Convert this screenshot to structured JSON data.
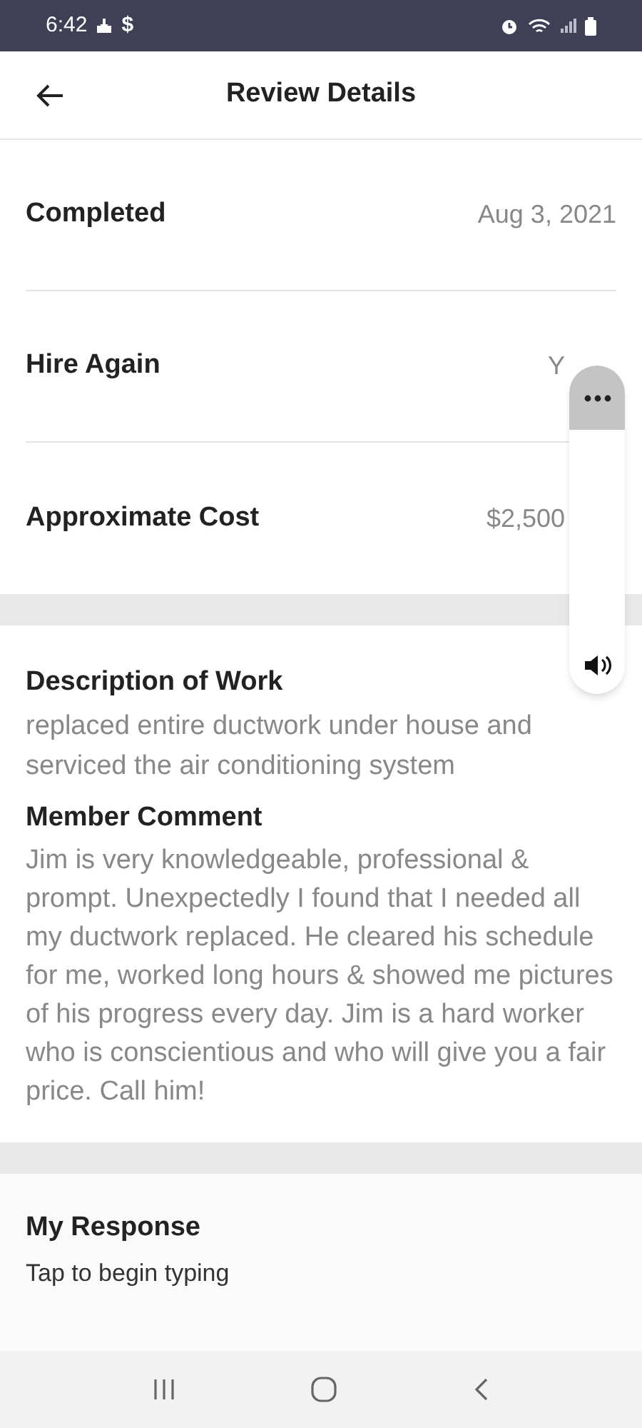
{
  "status_bar": {
    "time": "6:42",
    "currency_icon": "$"
  },
  "header": {
    "title": "Review Details"
  },
  "details": [
    {
      "label": "Completed",
      "value": "Aug 3, 2021"
    },
    {
      "label": "Hire Again",
      "value": "Y"
    },
    {
      "label": "Approximate Cost",
      "value": "$2,500"
    }
  ],
  "description": {
    "title": "Description of Work",
    "text": "replaced entire ductwork under house and serviced the air conditioning system"
  },
  "comment": {
    "title": "Member Comment",
    "text": "Jim is very knowledgeable, professional & prompt. Unexpectedly I found that I needed all my ductwork replaced. He cleared his schedule for me, worked long hours & showed me pictures of his progress every day. Jim is a hard worker who is conscientious and who will give you a fair price. Call him!"
  },
  "response": {
    "title": "My Response",
    "placeholder": "Tap to begin typing"
  }
}
